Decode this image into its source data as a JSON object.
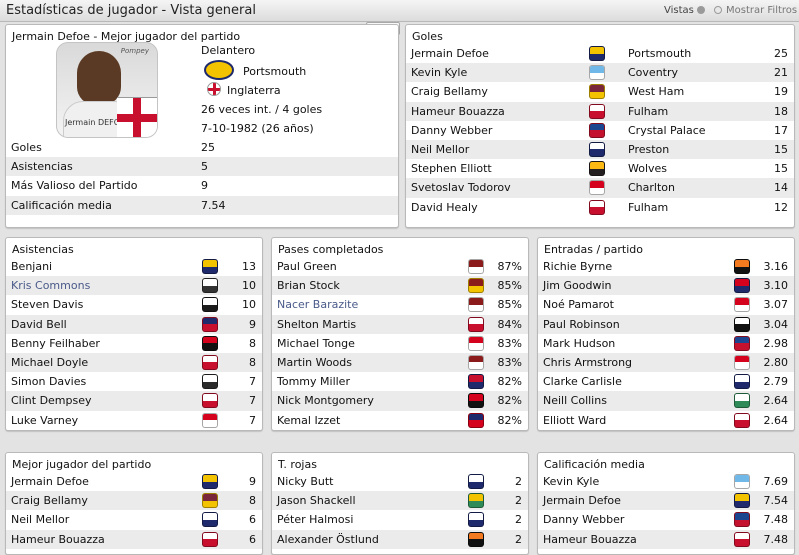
{
  "window": {
    "title": "Estadísticas de jugador - Vista general",
    "views": "Vistas",
    "show_filters": "Mostrar Filtros"
  },
  "player": {
    "header": "Jermain Defoe - Mejor jugador del partido",
    "photo_name": "Jermain DEFOE",
    "photo_logo": "Pompey",
    "position": "Delantero",
    "club": "Portsmouth",
    "nation": "Inglaterra",
    "caps": "26 veces int. / 4 goles",
    "dob": "7-10-1982 (26 años)",
    "stats": [
      {
        "label": "Goles",
        "value": "25"
      },
      {
        "label": "Asistencias",
        "value": "5"
      },
      {
        "label": "Más Valioso del Partido",
        "value": "9"
      },
      {
        "label": "Calificación media",
        "value": "7.54"
      }
    ]
  },
  "goals": {
    "title": "Goles",
    "rows": [
      {
        "name": "Jermain Defoe",
        "club": "Portsmouth",
        "value": "25",
        "c1": "#f3c300",
        "c2": "#1e2a6b"
      },
      {
        "name": "Kevin Kyle",
        "club": "Coventry",
        "value": "21",
        "c1": "#6fb8e8",
        "c2": "#ffffff"
      },
      {
        "name": "Craig Bellamy",
        "club": "West Ham",
        "value": "19",
        "c1": "#7a263a",
        "c2": "#f3c300"
      },
      {
        "name": "Hameur Bouazza",
        "club": "Fulham",
        "value": "18",
        "c1": "#ffffff",
        "c2": "#c8102e"
      },
      {
        "name": "Danny Webber",
        "club": "Crystal Palace",
        "value": "17",
        "c1": "#1b458f",
        "c2": "#c4122e"
      },
      {
        "name": "Neil Mellor",
        "club": "Preston",
        "value": "15",
        "c1": "#ffffff",
        "c2": "#1e2a6b"
      },
      {
        "name": "Stephen Elliott",
        "club": "Wolves",
        "value": "15",
        "c1": "#fdb913",
        "c2": "#231f20"
      },
      {
        "name": "Svetoslav Todorov",
        "club": "Charlton",
        "value": "14",
        "c1": "#d4021d",
        "c2": "#ffffff"
      },
      {
        "name": "David Healy",
        "club": "Fulham",
        "value": "12",
        "c1": "#ffffff",
        "c2": "#c8102e"
      }
    ]
  },
  "assists": {
    "title": "Asistencias",
    "rows": [
      {
        "name": "Benjani",
        "value": "13",
        "link": false,
        "c1": "#f3c300",
        "c2": "#1e2a6b"
      },
      {
        "name": "Kris Commons",
        "value": "10",
        "link": true,
        "c1": "#ffffff",
        "c2": "#333333"
      },
      {
        "name": "Steven Davis",
        "value": "10",
        "link": false,
        "c1": "#ffffff",
        "c2": "#1d1d1d"
      },
      {
        "name": "David Bell",
        "value": "9",
        "link": false,
        "c1": "#1e2a6b",
        "c2": "#c8102e"
      },
      {
        "name": "Benny Feilhaber",
        "value": "8",
        "link": false,
        "c1": "#d4021d",
        "c2": "#111111"
      },
      {
        "name": "Michael Doyle",
        "value": "8",
        "link": false,
        "c1": "#ffffff",
        "c2": "#c8102e"
      },
      {
        "name": "Simon Davies",
        "value": "7",
        "link": false,
        "c1": "#ffffff",
        "c2": "#2b2b2b"
      },
      {
        "name": "Clint Dempsey",
        "value": "7",
        "link": false,
        "c1": "#ffffff",
        "c2": "#c8102e"
      },
      {
        "name": "Luke Varney",
        "value": "7",
        "link": false,
        "c1": "#d4021d",
        "c2": "#ffffff"
      }
    ]
  },
  "passes": {
    "title": "Pases completados",
    "rows": [
      {
        "name": "Paul Green",
        "value": "87%",
        "link": false,
        "c1": "#8b1a1a",
        "c2": "#ffffff"
      },
      {
        "name": "Brian Stock",
        "value": "85%",
        "link": false,
        "c1": "#8b1a1a",
        "c2": "#f3c300"
      },
      {
        "name": "Nacer Barazite",
        "value": "85%",
        "link": true,
        "c1": "#8b1a1a",
        "c2": "#ffffff"
      },
      {
        "name": "Shelton Martis",
        "value": "84%",
        "link": false,
        "c1": "#ffffff",
        "c2": "#c8102e"
      },
      {
        "name": "Michael Tonge",
        "value": "83%",
        "link": false,
        "c1": "#d4021d",
        "c2": "#ffffff"
      },
      {
        "name": "Martin Woods",
        "value": "83%",
        "link": false,
        "c1": "#8b1a1a",
        "c2": "#ffffff"
      },
      {
        "name": "Tommy Miller",
        "value": "82%",
        "link": false,
        "c1": "#c8102e",
        "c2": "#1e2a6b"
      },
      {
        "name": "Nick Montgomery",
        "value": "82%",
        "link": false,
        "c1": "#d4021d",
        "c2": "#111111"
      },
      {
        "name": "Kemal Izzet",
        "value": "82%",
        "link": false,
        "c1": "#1e2a6b",
        "c2": "#d4021d"
      }
    ]
  },
  "tackles": {
    "title": "Entradas / partido",
    "rows": [
      {
        "name": "Richie Byrne",
        "value": "3.16",
        "c1": "#f47a20",
        "c2": "#111111"
      },
      {
        "name": "Jim Goodwin",
        "value": "3.10",
        "c1": "#d4021d",
        "c2": "#1e2a6b"
      },
      {
        "name": "Noé Pamarot",
        "value": "3.07",
        "c1": "#d4021d",
        "c2": "#ffffff"
      },
      {
        "name": "Paul Robinson",
        "value": "3.04",
        "c1": "#ffffff",
        "c2": "#111111"
      },
      {
        "name": "Mark Hudson",
        "value": "2.98",
        "c1": "#1b458f",
        "c2": "#c4122e"
      },
      {
        "name": "Chris Armstrong",
        "value": "2.80",
        "c1": "#d4021d",
        "c2": "#ffffff"
      },
      {
        "name": "Clarke Carlisle",
        "value": "2.79",
        "c1": "#ffffff",
        "c2": "#1e2a6b"
      },
      {
        "name": "Neill Collins",
        "value": "2.64",
        "c1": "#ffffff",
        "c2": "#2e8b57"
      },
      {
        "name": "Elliott Ward",
        "value": "2.64",
        "c1": "#ffffff",
        "c2": "#c8102e"
      }
    ]
  },
  "motm": {
    "title": "Mejor jugador del partido",
    "rows": [
      {
        "name": "Jermain Defoe",
        "value": "9",
        "c1": "#f3c300",
        "c2": "#1e2a6b"
      },
      {
        "name": "Craig Bellamy",
        "value": "8",
        "c1": "#7a263a",
        "c2": "#f3c300"
      },
      {
        "name": "Neil Mellor",
        "value": "6",
        "c1": "#ffffff",
        "c2": "#1e2a6b"
      },
      {
        "name": "Hameur Bouazza",
        "value": "6",
        "c1": "#ffffff",
        "c2": "#c8102e"
      }
    ]
  },
  "reds": {
    "title": "T. rojas",
    "rows": [
      {
        "name": "Nicky Butt",
        "value": "2",
        "c1": "#ffffff",
        "c2": "#1e2a6b"
      },
      {
        "name": "Jason Shackell",
        "value": "2",
        "c1": "#f3c300",
        "c2": "#2e8b57"
      },
      {
        "name": "Péter Halmosi",
        "value": "2",
        "c1": "#ffffff",
        "c2": "#1e2a6b"
      },
      {
        "name": "Alexander Östlund",
        "value": "2",
        "c1": "#f47a20",
        "c2": "#111111"
      }
    ]
  },
  "rating": {
    "title": "Calificación media",
    "rows": [
      {
        "name": "Kevin Kyle",
        "value": "7.69",
        "c1": "#6fb8e8",
        "c2": "#ffffff"
      },
      {
        "name": "Jermain Defoe",
        "value": "7.54",
        "c1": "#f3c300",
        "c2": "#1e2a6b"
      },
      {
        "name": "Danny Webber",
        "value": "7.48",
        "c1": "#1b458f",
        "c2": "#c4122e"
      },
      {
        "name": "Hameur Bouazza",
        "value": "7.48",
        "c1": "#ffffff",
        "c2": "#c8102e"
      }
    ]
  }
}
